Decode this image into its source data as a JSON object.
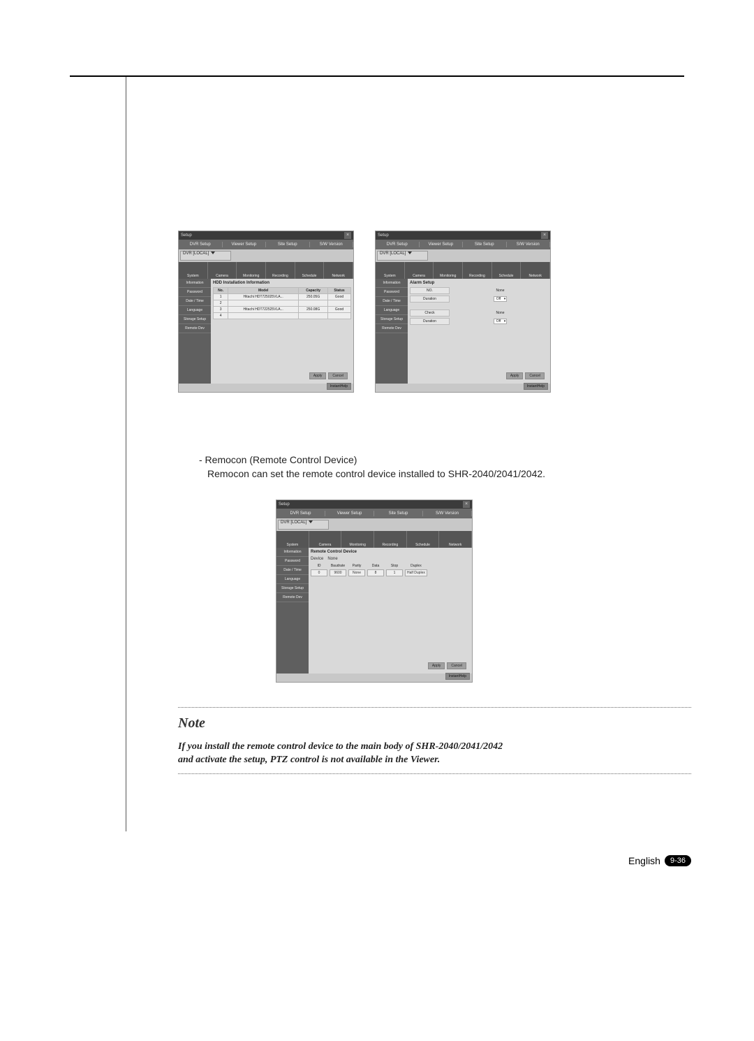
{
  "page": {
    "lang": "English",
    "num": "9-36"
  },
  "text": {
    "remocon_title": "- Remocon (Remote Control Device)",
    "remocon_desc": "Remocon can set the remote control device installed to SHR-2040/2041/2042.",
    "note_heading": "Note",
    "note_body_1": "If you install the remote control device to the main body of SHR-2040/2041/2042",
    "note_body_2": "and activate the setup, PTZ control is not available in the Viewer."
  },
  "setup_common": {
    "window_title": "Setup",
    "tabs": [
      "DVR Setup",
      "Viewer Setup",
      "Site Setup",
      "S/W Version"
    ],
    "dvr_select": "DVR [LOCAL]",
    "tabbar": [
      "System",
      "Camera",
      "Monitoring",
      "Recording",
      "Schedule",
      "Network"
    ],
    "side": [
      "Information",
      "Password",
      "Date / Time",
      "Language",
      "Storage Setup",
      "Remote Dev"
    ],
    "buttons": {
      "apply": "Apply",
      "cancel": "Cancel",
      "help": "InstantHelp"
    }
  },
  "hdd_panel": {
    "title": "HDD Installation Information",
    "headers": [
      "No.",
      "Model",
      "Capacity",
      "Status"
    ],
    "rows": [
      {
        "no": "1",
        "model": "Hitachi HDT725025VLA...",
        "cap": "250.05G",
        "status": "Good"
      },
      {
        "no": "2",
        "model": "",
        "cap": "",
        "status": ""
      },
      {
        "no": "3",
        "model": "Hitachi HDT722525VLA...",
        "cap": "250.08G",
        "status": "Good"
      },
      {
        "no": "4",
        "model": "",
        "cap": "",
        "status": ""
      }
    ]
  },
  "alarm_panel": {
    "title": "Alarm Setup",
    "group1_label": "NO.",
    "group1_value": "None",
    "duration_label": "Duration",
    "duration_value": "Off",
    "group2_label": "Check",
    "group2_value": "None"
  },
  "remote_panel": {
    "title": "Remote Control Device",
    "device_label": "Device",
    "device_value": "None",
    "cols": [
      "ID",
      "Baudrate",
      "Parity",
      "Data",
      "Stop",
      "Duplex"
    ],
    "vals": [
      "0",
      "9600",
      "None",
      "8",
      "1",
      "Half Duplex"
    ]
  }
}
